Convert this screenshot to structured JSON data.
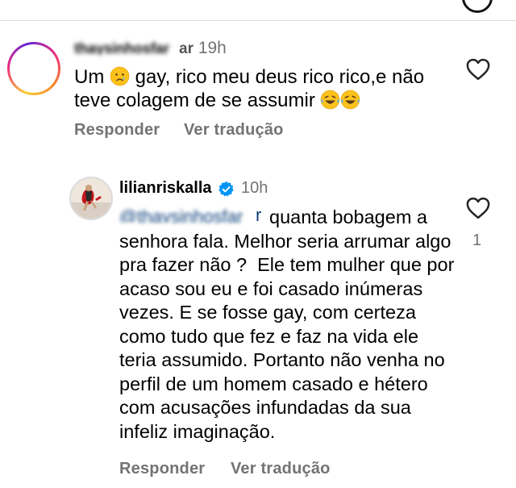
{
  "comment": {
    "username": "thaysinhosfar",
    "time": "19h",
    "time_prefix": "ar",
    "text_part1": "Um ",
    "text_part2": " gay, rico meu deus rico rico,e não teve colagem de se assumir ",
    "emoji_sad": "crying-face-emoji",
    "emoji_laugh": "tears-of-joy-emoji",
    "reply_label": "Responder",
    "translate_label": "Ver tradução",
    "like_icon": "heart-outline-icon"
  },
  "reply": {
    "username": "lilianriskalla",
    "verified_icon": "verified-badge-icon",
    "time": "10h",
    "mention": "@thaysinhosfar",
    "mention_tail": "r",
    "text": "quanta bobagem a senhora fala. Melhor seria arrumar algo pra fazer não ?  Ele tem mulher que por acaso sou eu e foi casado inúmeras vezes. E se fosse gay, com certeza como tudo que fez e faz na vida ele teria assumido. Portanto não venha no perfil de um homem casado e hétero com acusações infundadas da sua infeliz imaginação.",
    "like_count": "1",
    "reply_label": "Responder",
    "translate_label": "Ver tradução",
    "like_icon": "heart-outline-icon"
  },
  "colors": {
    "secondary_text": "#737373",
    "mention": "#0b3f7a",
    "verified": "#0095f6"
  }
}
